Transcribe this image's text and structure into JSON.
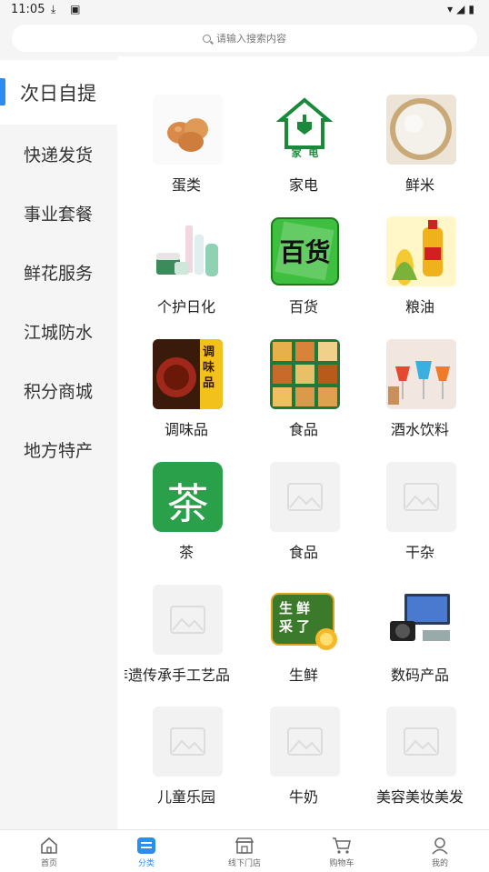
{
  "status": {
    "time": "11:05"
  },
  "search": {
    "placeholder": "请输入搜索内容"
  },
  "sidebar": {
    "items": [
      {
        "label": "次日自提",
        "active": true
      },
      {
        "label": "快递发货"
      },
      {
        "label": "事业套餐"
      },
      {
        "label": "鲜花服务"
      },
      {
        "label": "江城防水"
      },
      {
        "label": "积分商城"
      },
      {
        "label": "地方特产"
      }
    ]
  },
  "categories": [
    {
      "label": "蛋类",
      "icon": "eggs-image"
    },
    {
      "label": "家电",
      "icon": "home-appliance-logo"
    },
    {
      "label": "鲜米",
      "icon": "rice-image"
    },
    {
      "label": "个护日化",
      "icon": "cosmetics-image"
    },
    {
      "label": "百货",
      "icon": "department-store-logo"
    },
    {
      "label": "粮油",
      "icon": "cooking-oil-image"
    },
    {
      "label": "调味品",
      "icon": "seasoning-image"
    },
    {
      "label": "食品",
      "icon": "food-grid-image"
    },
    {
      "label": "酒水饮料",
      "icon": "drinks-image"
    },
    {
      "label": "茶",
      "icon": "tea-logo"
    },
    {
      "label": "食品",
      "icon": "placeholder-image"
    },
    {
      "label": "干杂",
      "icon": "placeholder-image"
    },
    {
      "label": "非遗传承手工艺品",
      "icon": "placeholder-image"
    },
    {
      "label": "生鲜",
      "icon": "fresh-produce-logo"
    },
    {
      "label": "数码产品",
      "icon": "digital-products-image"
    },
    {
      "label": "儿童乐园",
      "icon": "placeholder-image"
    },
    {
      "label": "牛奶",
      "icon": "placeholder-image"
    },
    {
      "label": "美容美妆美发",
      "icon": "placeholder-image"
    }
  ],
  "logo_text": {
    "appliance": "家  电",
    "store": "百货",
    "seasoning": "调味品",
    "tea": "茶",
    "fresh": "生鲜采了"
  },
  "tabs": [
    {
      "label": "首页",
      "icon": "home-icon"
    },
    {
      "label": "分类",
      "icon": "category-icon",
      "active": true
    },
    {
      "label": "线下门店",
      "icon": "store-icon"
    },
    {
      "label": "购物车",
      "icon": "cart-icon"
    },
    {
      "label": "我的",
      "icon": "profile-icon"
    }
  ],
  "colors": {
    "accent": "#2d8cf0",
    "sidebar_bg": "#f5f5f5",
    "appliance_green": "#1a8a3a",
    "tea_green": "#2aa04a"
  }
}
